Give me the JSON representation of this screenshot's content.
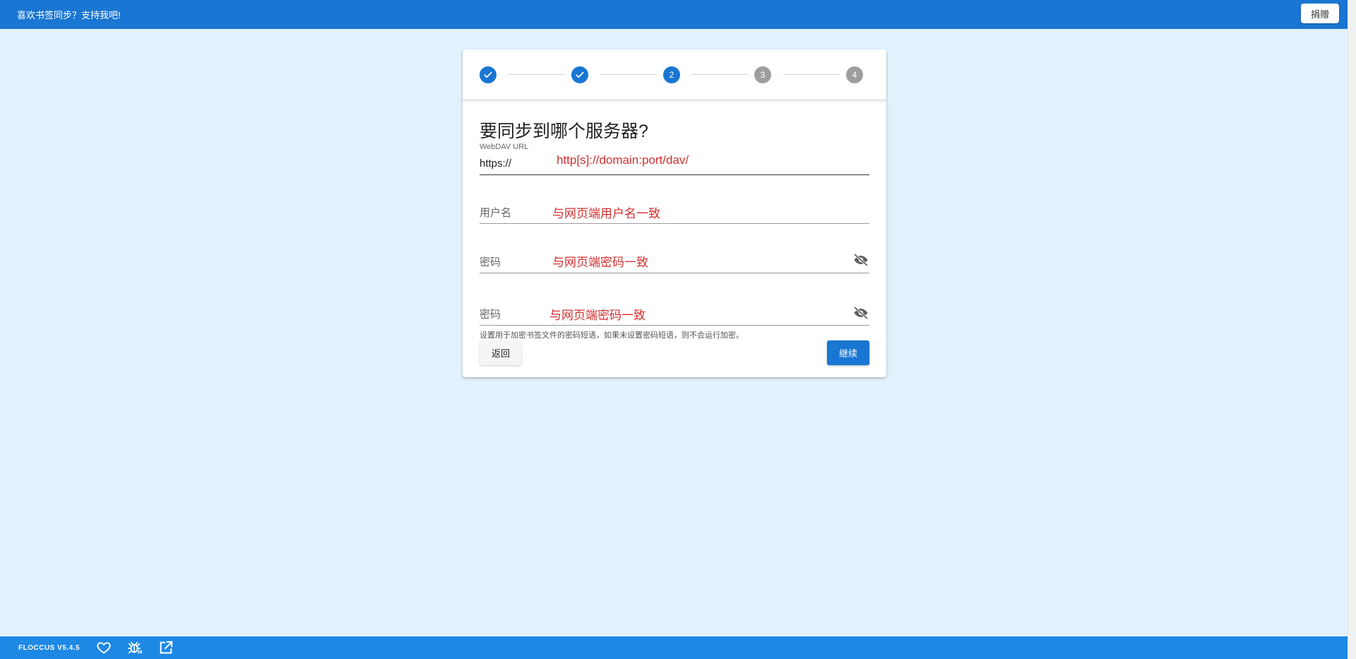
{
  "topbar": {
    "message": "喜欢书签同步？支持我吧!",
    "donate_label": "捐赠"
  },
  "stepper": {
    "steps": [
      {
        "state": "done",
        "label": ""
      },
      {
        "state": "done",
        "label": ""
      },
      {
        "state": "active",
        "label": "2"
      },
      {
        "state": "pending",
        "label": "3"
      },
      {
        "state": "pending",
        "label": "4"
      }
    ]
  },
  "form": {
    "title": "要同步到哪个服务器?",
    "url": {
      "label": "WebDAV URL",
      "value": "https://",
      "hint": "http[s]://domain:port/dav/"
    },
    "username": {
      "label": "用户名",
      "hint": "与网页端用户名一致"
    },
    "password": {
      "label": "密码",
      "hint": "与网页端密码一致"
    },
    "passphrase": {
      "label": "密码",
      "hint": "与网页端密码一致",
      "helper": "设置用于加密书签文件的密码短语，如果未设置密码短语，则不会运行加密。"
    },
    "back_label": "返回",
    "continue_label": "继续"
  },
  "bottombar": {
    "version": "FLOCCUS V5.4.5",
    "icons": [
      "heart-icon",
      "bug-icon",
      "open-external-icon"
    ]
  },
  "colors": {
    "primary": "#1976d2",
    "bottom_bar": "#1e88e5",
    "background": "#e1f2fd",
    "pending_step": "#9e9e9e",
    "hint_red": "#d32f2f"
  }
}
